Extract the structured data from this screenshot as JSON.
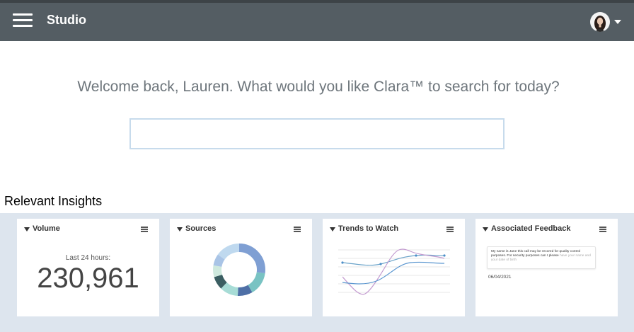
{
  "header": {
    "app_title": "Studio",
    "menu_icon": "hamburger-menu-icon",
    "avatar_icon": "user-avatar",
    "caret_icon": "caret-down-icon",
    "background": "#545d63"
  },
  "main": {
    "welcome_text": "Welcome back, Lauren. What would you like Clara™ to search for today?",
    "search": {
      "value": "",
      "placeholder": ""
    }
  },
  "insights": {
    "title": "Relevant Insights",
    "cards": [
      {
        "title": "Volume",
        "label": "Last 24 hours:",
        "value": "230,961"
      },
      {
        "title": "Sources"
      },
      {
        "title": "Trends to Watch"
      },
      {
        "title": "Associated Feedback",
        "feedback_text": "My name is Jane this call may be recored for quality control purposes.  For security purposes can I please",
        "feedback_text_faded": "have your name and your date of birth",
        "date": "06/04/2021"
      }
    ]
  },
  "colors": {
    "accent_blue": "#7f9fd3",
    "insights_background": "#dde5ee",
    "search_border": "#c7dbec"
  }
}
